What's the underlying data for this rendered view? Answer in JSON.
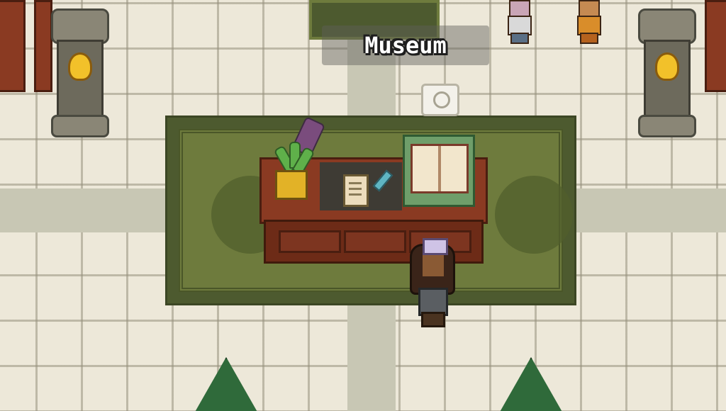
{
  "location": {
    "name": "Museum"
  },
  "colors": {
    "floor": "#ede8d9",
    "rug": "#4d5a2f",
    "desk": "#8a3a22",
    "label_bg": "rgba(95,95,90,0.45)"
  },
  "icons": {
    "interaction_prompt": "speech-bubble-icon"
  }
}
